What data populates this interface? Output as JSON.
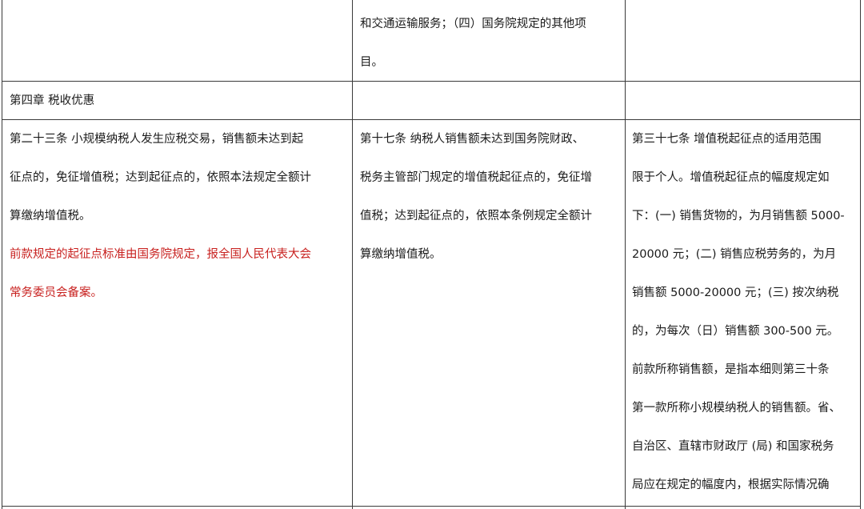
{
  "row_top": {
    "col2": [
      "和交通运输服务；（四）国务院规定的其他项",
      "目。"
    ]
  },
  "row_chapter": {
    "col1": "第四章  税收优惠"
  },
  "row_main": {
    "col1": {
      "black": [
        "第二十三条  小规模纳税人发生应税交易，销售额未达到起",
        "征点的，免征增值税；达到起征点的，依照本法规定全额计",
        "算缴纳增值税。"
      ],
      "red": [
        "前款规定的起征点标准由国务院规定，报全国人民代表大会",
        "常务委员会备案。"
      ]
    },
    "col2": [
      "第十七条  纳税人销售额未达到国务院财政、",
      "税务主管部门规定的增值税起征点的，免征增",
      "值税；达到起征点的，依照本条例规定全额计",
      "算缴纳增值税。"
    ],
    "col3": [
      "第三十七条    增值税起征点的适用范围",
      "限于个人。增值税起征点的幅度规定如",
      "下：(一) 销售货物的，为月销售额 5000-",
      "20000 元；(二) 销售应税劳务的，为月",
      "销售额 5000-20000 元；(三) 按次纳税",
      "的，为每次（日）销售额 300-500 元。",
      "前款所称销售额，是指本细则第三十条",
      "第一款所称小规模纳税人的销售额。省、",
      "自治区、直辖市财政厅 (局) 和国家税务",
      "局应在规定的幅度内，根据实际情况确"
    ]
  }
}
